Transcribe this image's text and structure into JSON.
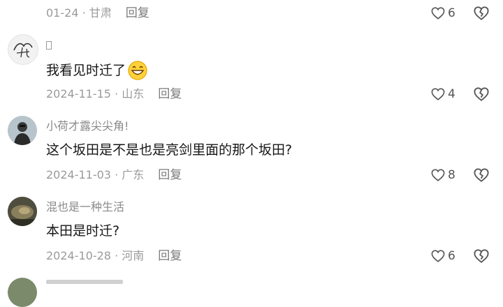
{
  "comments": [
    {
      "username": "",
      "text": "",
      "date": "01-24",
      "location": "甘肃",
      "reply_label": "回复",
      "likes": "6"
    },
    {
      "username": "",
      "text": "我看见时迁了",
      "emoji": "grinning-face-emoji",
      "date": "2024-11-15",
      "location": "山东",
      "reply_label": "回复",
      "likes": "4"
    },
    {
      "username": "小荷才露尖尖角!",
      "text": "这个坂田是不是也是亮剑里面的那个坂田?",
      "date": "2024-11-03",
      "location": "广东",
      "reply_label": "回复",
      "likes": "8"
    },
    {
      "username": "混也是一种生活",
      "text": "本田是时迁?",
      "date": "2024-10-28",
      "location": "河南",
      "reply_label": "回复",
      "likes": "6"
    }
  ],
  "meta_separator": " · ",
  "icons": {
    "like": "heart-outline-icon",
    "dislike": "broken-heart-outline-icon"
  },
  "colors": {
    "text_primary": "#161616",
    "text_secondary": "#9a9a9a",
    "icon": "#555555"
  }
}
